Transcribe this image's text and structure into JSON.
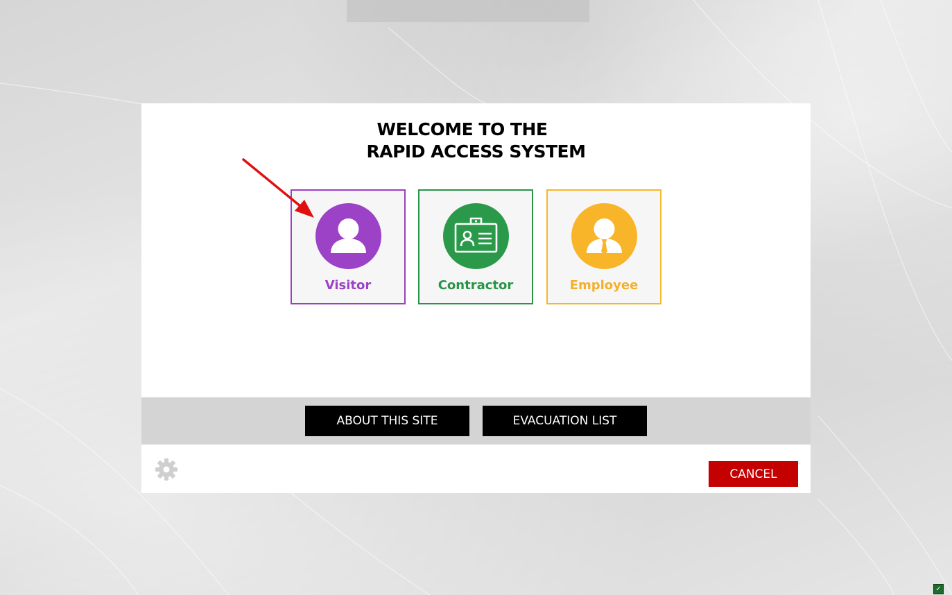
{
  "welcome": {
    "line1": "WELCOME TO THE",
    "line2": "RAPID ACCESS SYSTEM"
  },
  "cards": [
    {
      "label": "Visitor",
      "icon": "visitor-person-icon",
      "color": "#9b42c6"
    },
    {
      "label": "Contractor",
      "icon": "id-badge-icon",
      "color": "#2a9a4a"
    },
    {
      "label": "Employee",
      "icon": "employee-tie-icon",
      "color": "#f9b52a"
    }
  ],
  "actions": {
    "about": "ABOUT THIS SITE",
    "evacuation": "EVACUATION LIST",
    "cancel": "CANCEL"
  },
  "settings": {
    "icon": "gear-icon"
  },
  "tray": {
    "status_icon": "checkmark-icon",
    "status_mark": "✓"
  },
  "colors": {
    "cancel": "#c40000",
    "bar": "#d4d4d4"
  }
}
